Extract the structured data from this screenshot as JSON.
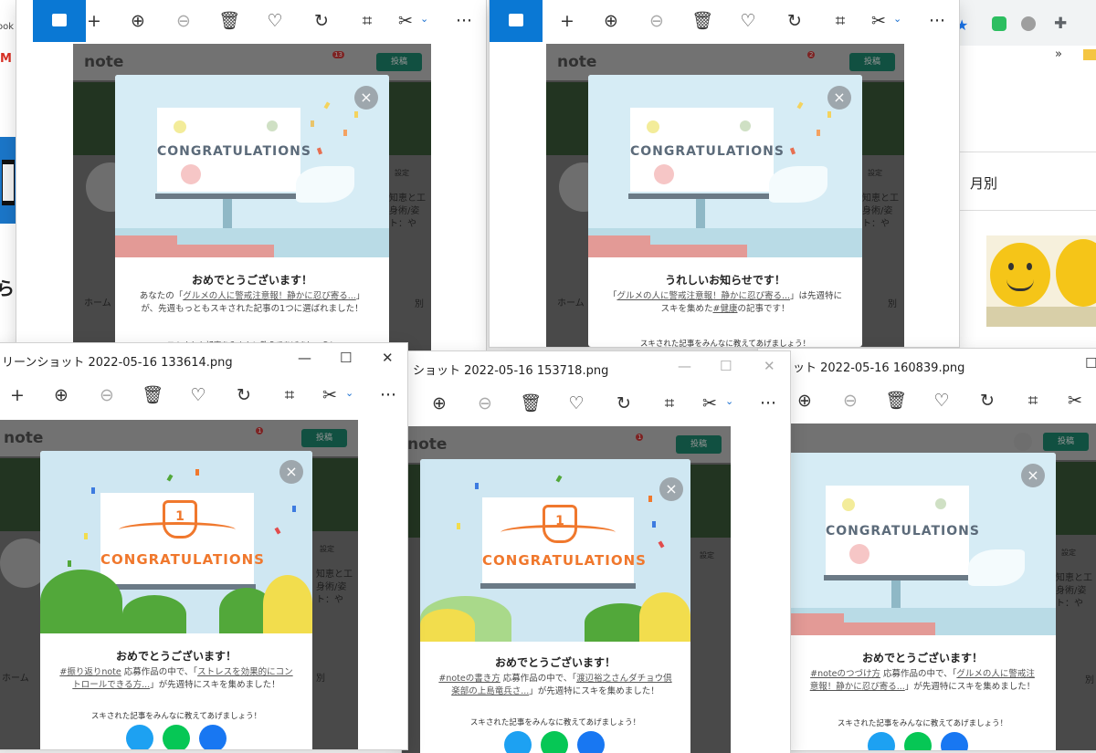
{
  "browser_right": {
    "chevron": "»",
    "sidebar_text": "月別",
    "smiley_caption": "smiley-plush-photo"
  },
  "left_background": {
    "gmail_letter": "M",
    "bookmark_text": "ook",
    "fragment": "ら 彦"
  },
  "viewer_toolbar": {
    "add": "+",
    "more": "···",
    "chevron": "⌄"
  },
  "note_page": {
    "logo": "note",
    "post_button": "投稿",
    "settings": "設定",
    "home_tab": "ホーム",
    "monthly": "別",
    "profile_lines": [
      "知恵と工",
      "身術/姿",
      "ト：や"
    ],
    "badges": [
      "13",
      "2",
      "1",
      "1",
      "1"
    ]
  },
  "windows": [
    {
      "title": ""
    },
    {
      "title": ""
    },
    {
      "title": "リーンショット 2022-05-16 133614.png"
    },
    {
      "title": "ショット 2022-05-16 153718.png"
    },
    {
      "title": "ショット 2022-05-16 160839.png"
    }
  ],
  "modals": {
    "m1": {
      "banner": "CONGRATULATIONS",
      "heading": "おめでとうございます！",
      "body_prefix": "あなたの「",
      "body_link": "グルメの人に警戒注意報！静かに忍び寄る...",
      "body_suffix": "」が、先週もっともスキされた記事の1つに選ばれました！",
      "share": "スキされた記事をみんなに教えてあげましょう！"
    },
    "m2": {
      "banner": "CONGRATULATIONS",
      "heading": "うれしいお知らせです！",
      "body_prefix": "「",
      "body_link": "グルメの人に警戒注意報！静かに忍び寄る...",
      "body_mid": "」は先週特にスキを集めた",
      "body_tag": "#健康",
      "body_suffix": "の記事です！",
      "share": "スキされた記事をみんなに教えてあげましょう！"
    },
    "m3": {
      "banner": "CONGRATULATIONS",
      "trophy_number": "1",
      "heading": "おめでとうございます！",
      "body_tag": "#振り返りnote",
      "body_mid": " 応募作品の中で、「",
      "body_link": "ストレスを効果的にコントロールできる方...",
      "body_suffix": "」が先週特にスキを集めました！",
      "share": "スキされた記事をみんなに教えてあげましょう！"
    },
    "m4": {
      "banner": "CONGRATULATIONS",
      "trophy_number": "1",
      "heading": "おめでとうございます！",
      "body_tag": "#noteの書き方",
      "body_mid": " 応募作品の中で、「",
      "body_link": "渡辺裕之さんダチョウ倶楽部の上島竜兵さ...",
      "body_suffix": "」が先週特にスキを集めました！",
      "share": "スキされた記事をみんなに教えてあげましょう！"
    },
    "m5": {
      "banner": "CONGRATULATIONS",
      "heading": "おめでとうございます！",
      "body_tag": "#noteのつづけ方",
      "body_mid": " 応募作品の中で、「",
      "body_link": "グルメの人に警戒注意報！静かに忍び寄る...",
      "body_suffix": "」が先週特にスキを集めました！",
      "share": "スキされた記事をみんなに教えてあげましょう！"
    }
  },
  "colors": {
    "accent_blue": "#0a78d4",
    "note_green": "#2cb696",
    "scene_sky": "#d6ecf5",
    "banner_gray": "#5c6b7a",
    "trophy_orange": "#f0782d",
    "twitter": "#1da1f2",
    "line": "#06c755",
    "facebook": "#1877f2"
  }
}
